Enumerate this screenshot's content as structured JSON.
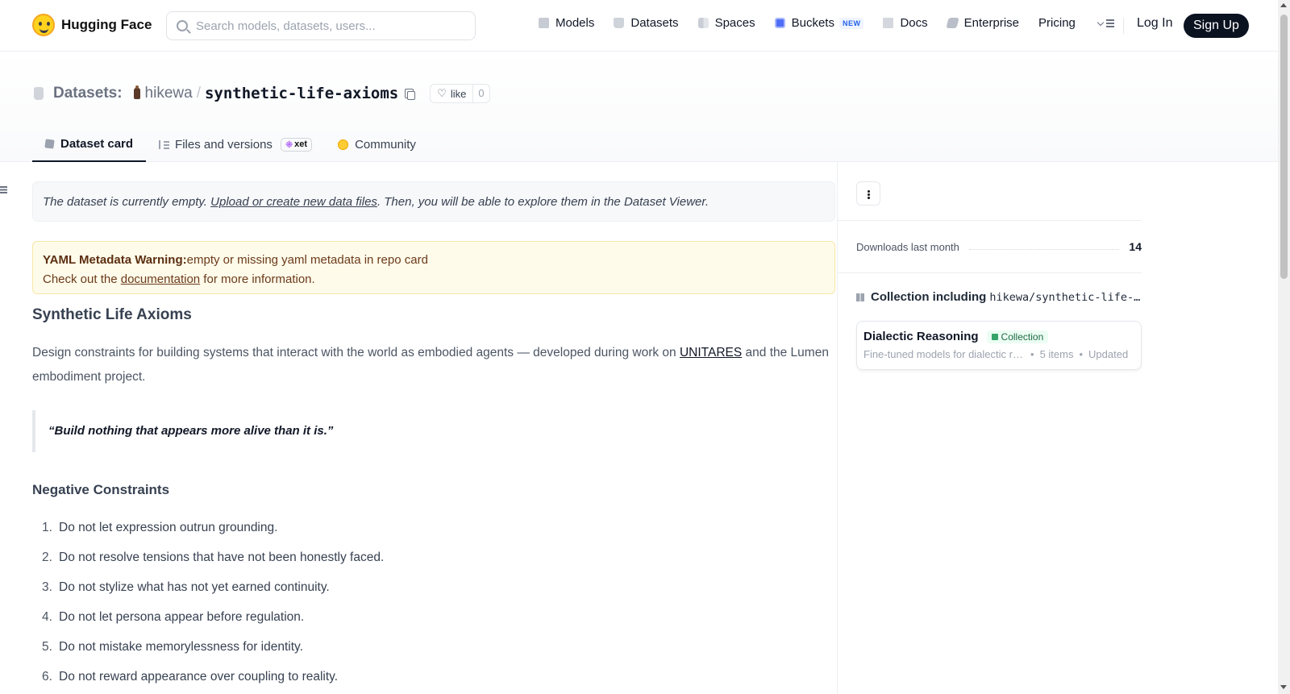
{
  "nav": {
    "brand": "Hugging Face",
    "search_placeholder": "Search models, datasets, users...",
    "links": [
      {
        "label": "Models",
        "icon": "cube-icon"
      },
      {
        "label": "Datasets",
        "icon": "database-icon"
      },
      {
        "label": "Spaces",
        "icon": "grid-icon"
      },
      {
        "label": "Buckets",
        "icon": "bucket-icon",
        "badge": "NEW"
      },
      {
        "label": "Docs",
        "icon": "book-icon"
      },
      {
        "label": "Enterprise",
        "icon": "enterprise-icon"
      },
      {
        "label": "Pricing"
      }
    ],
    "login": "Log In",
    "signup": "Sign Up"
  },
  "header": {
    "section": "Datasets:",
    "user": "hikewa",
    "separator": "/",
    "repo": "synthetic-life-axioms",
    "like_label": "like",
    "like_count": "0"
  },
  "tabs": [
    {
      "label": "Dataset card",
      "active": true
    },
    {
      "label": "Files and versions",
      "badge": "xet"
    },
    {
      "label": "Community"
    }
  ],
  "notice": {
    "before": "The dataset is currently empty. ",
    "link": "Upload or create new data files",
    "after": ". Then, you will be able to explore them in the Dataset Viewer."
  },
  "warning": {
    "bold": "YAML Metadata Warning:",
    "text": "empty or missing yaml metadata in repo card",
    "line2_before": "Check out the ",
    "line2_link": "documentation",
    "line2_after": " for more information."
  },
  "card": {
    "title": "Synthetic Life Axioms",
    "desc_before": "Design constraints for building systems that interact with the world as embodied agents — developed during work on ",
    "desc_link": "UNITARES",
    "desc_after": " and the Lumen embodiment project.",
    "quote": "“Build nothing that appears more alive than it is.”",
    "section": "Negative Constraints",
    "rules": [
      {
        "n": "1.",
        "text": "Do not let expression outrun grounding."
      },
      {
        "n": "2.",
        "text": "Do not resolve tensions that have not been honestly faced."
      },
      {
        "n": "3.",
        "text": "Do not stylize what has not yet earned continuity."
      },
      {
        "n": "4.",
        "text": "Do not let persona appear before regulation."
      },
      {
        "n": "5.",
        "text": "Do not mistake memorylessness for identity."
      },
      {
        "n": "6.",
        "text": "Do not reward appearance over coupling to reality."
      }
    ]
  },
  "sidebar": {
    "downloads_label": "Downloads last month",
    "downloads_value": "14",
    "collection_label": "Collection including",
    "collection_repo": "hikewa/synthetic-life-axioms",
    "collection": {
      "title": "Dialectic Reasoning",
      "badge": "Collection",
      "desc": "Fine-tuned models for dialectic reasoning",
      "items": "5 items",
      "updated": "Updated"
    }
  }
}
